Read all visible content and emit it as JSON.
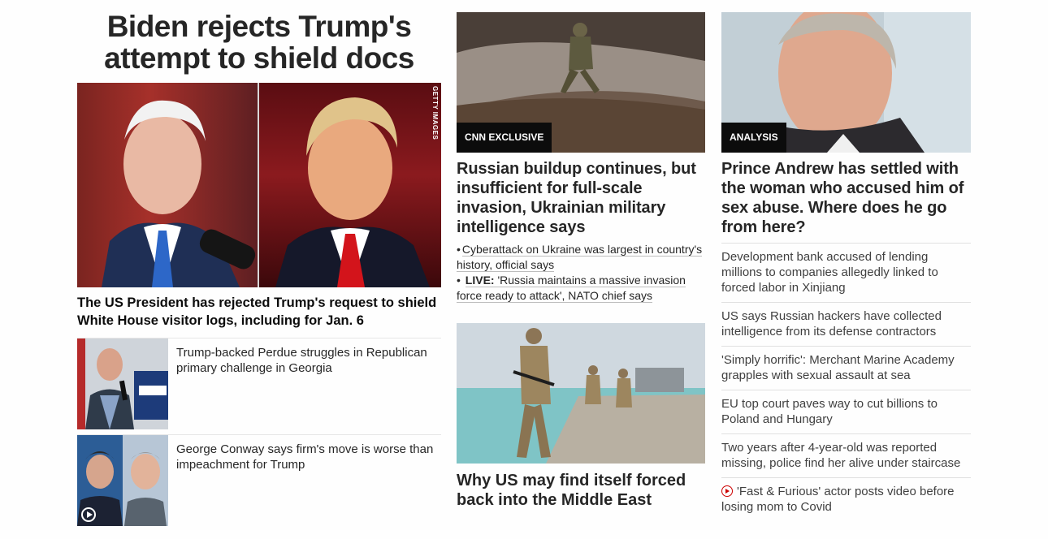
{
  "column1": {
    "banner": "Biden rejects Trump's attempt to shield docs",
    "lead_image": {
      "credit": "GETTY IMAGES",
      "depicts": [
        "Joe Biden",
        "Donald Trump"
      ]
    },
    "lead_text": "The US President has rejected Trump's request to shield White House visitor logs, including for Jan. 6",
    "cards": [
      {
        "headline": "Trump-backed Perdue struggles in Republican primary challenge in Georgia",
        "video": false
      },
      {
        "headline": "George Conway says firm's move is worse than impeachment for Trump",
        "video": true
      }
    ]
  },
  "column2": {
    "story1": {
      "label": "CNN EXCLUSIVE",
      "headline": "Russian buildup continues, but insufficient for full-scale invasion, Ukrainian military intelligence says",
      "related": [
        {
          "prefix": "",
          "text": "Cyberattack on Ukraine was largest in country's history, official says"
        },
        {
          "prefix": "LIVE:",
          "text": "'Russia maintains a massive invasion force ready to attack', NATO chief says"
        }
      ]
    },
    "story2": {
      "headline": "Why US may find itself forced back into the Middle East"
    }
  },
  "column3": {
    "label": "ANALYSIS",
    "headline": "Prince Andrew has settled with the woman who accused him of sex abuse. Where does he go from here?",
    "list": [
      {
        "text": "Development bank accused of lending millions to companies allegedly linked to forced labor in Xinjiang",
        "video": false
      },
      {
        "text": "US says Russian hackers have collected intelligence from its defense contractors",
        "video": false
      },
      {
        "text": "'Simply horrific': Merchant Marine Academy grapples with sexual assault at sea",
        "video": false
      },
      {
        "text": "EU top court paves way to cut billions to Poland and Hungary",
        "video": false
      },
      {
        "text": "Two years after 4-year-old was reported missing, police find her alive under staircase",
        "video": false
      },
      {
        "text": "'Fast & Furious' actor posts video before losing mom to Covid",
        "video": true
      }
    ]
  },
  "colors": {
    "label_bg": "#0c0c0c",
    "video_icon": "#cc0000",
    "text": "#262626"
  }
}
